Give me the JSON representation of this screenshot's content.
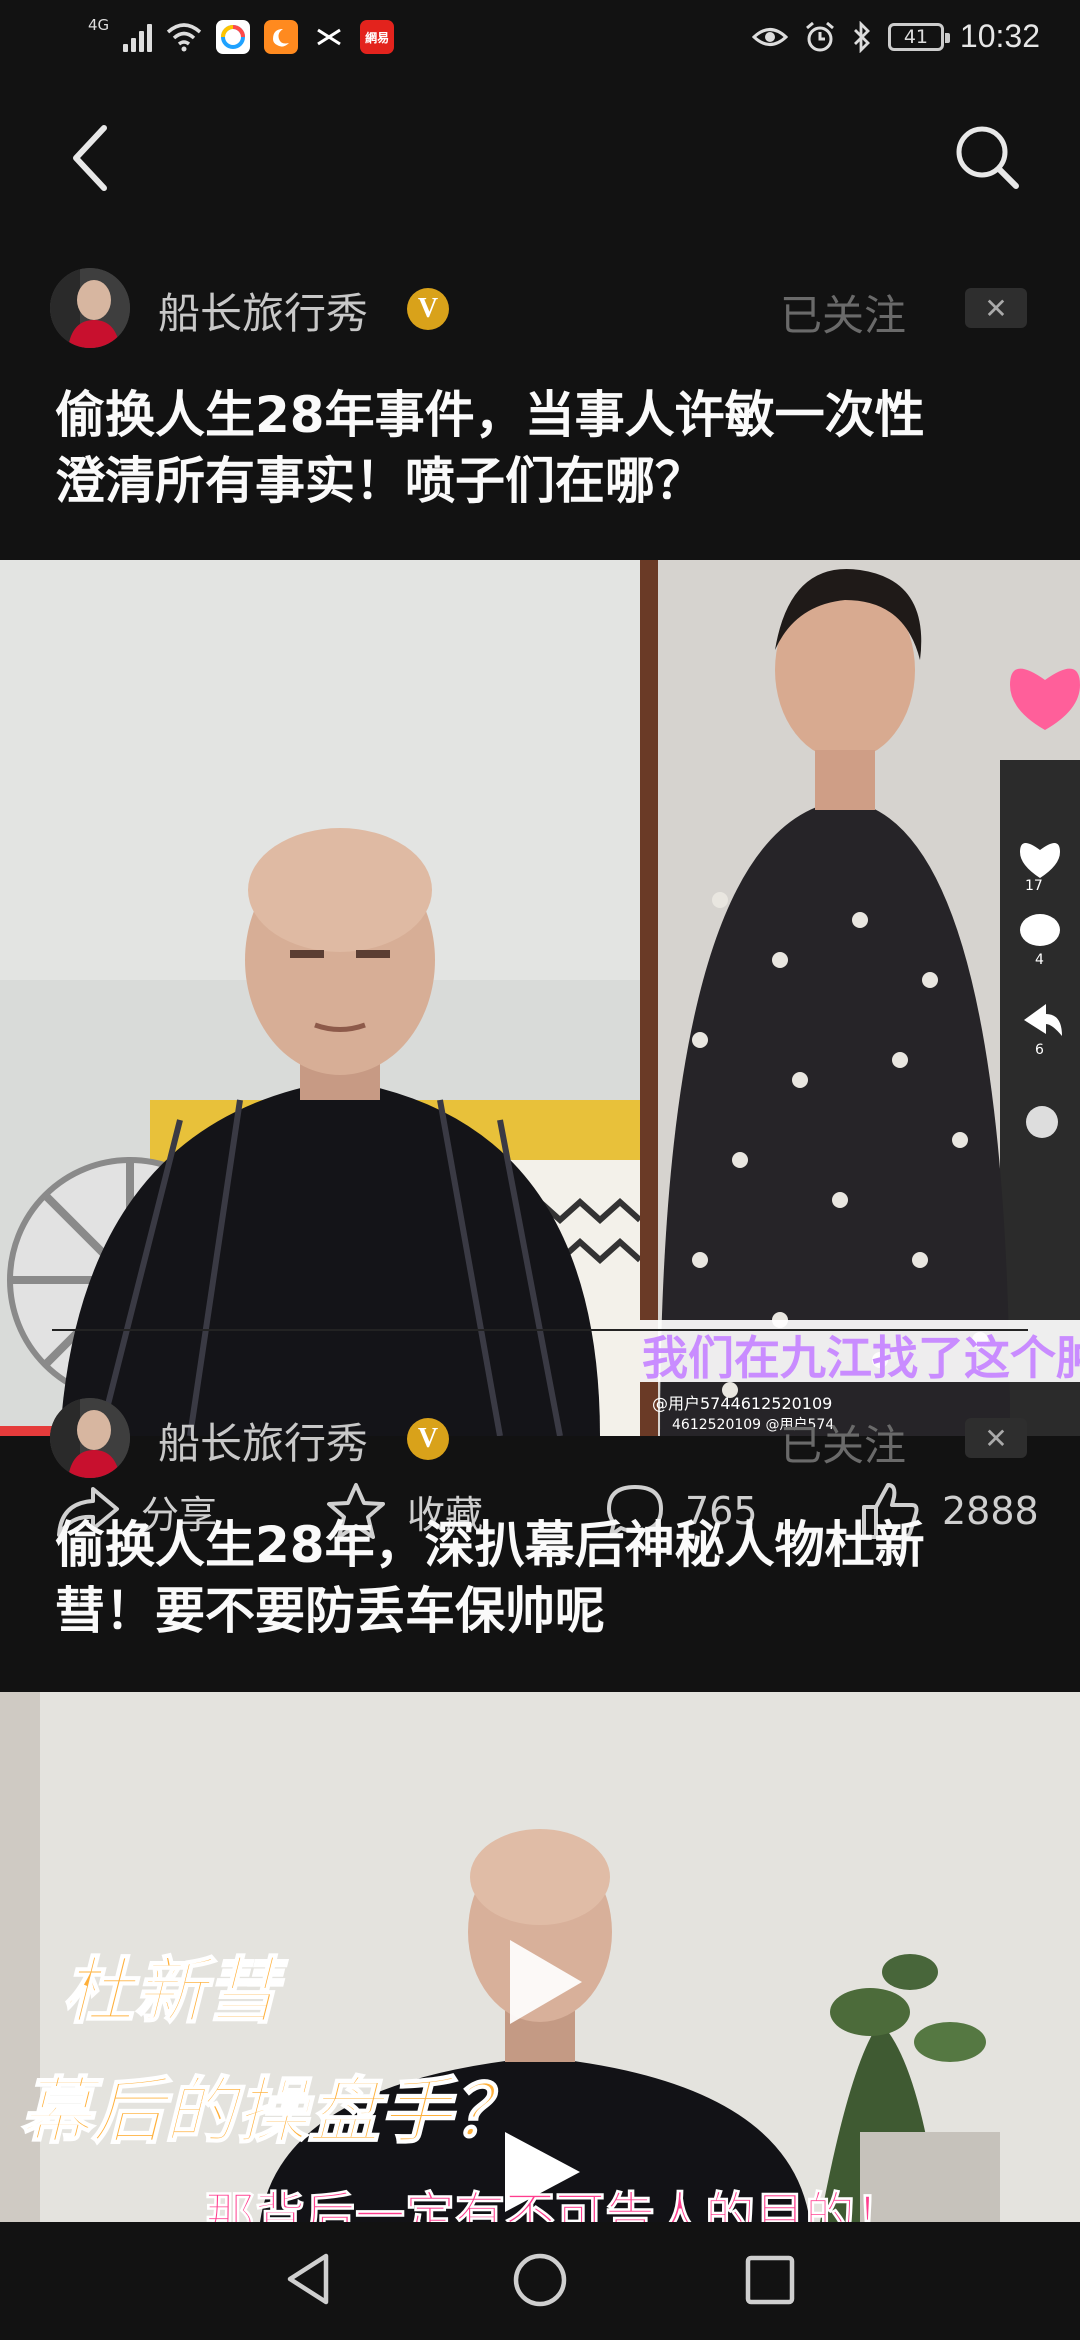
{
  "status_bar": {
    "network": "4G",
    "time": "10:32",
    "battery": "41",
    "app_icons": [
      "browser-app-icon",
      "uc-browser-app-icon",
      "capcut-app-icon",
      "netease-app-icon"
    ],
    "netease_label": "網易"
  },
  "nav": {
    "back_icon": "chevron-left-icon",
    "search_icon": "search-icon"
  },
  "posts": [
    {
      "author": "船长旅行秀",
      "verified": "V",
      "follow_label": "已关注",
      "dismiss": "✕",
      "title_line1": "偷换人生28年事件，当事人许敏一次性",
      "title_line2": "澄清所有事实！喷子们在哪？",
      "overlay_caption": "我们在九江找了这个肿",
      "overlay_user": "@用户5744612520109",
      "overlay_user2": "4612520109 @用户574",
      "side_counts": [
        "17",
        "4",
        "6"
      ],
      "share_label": "分享",
      "favorite_label": "收藏",
      "comments": "765",
      "likes": "2888"
    },
    {
      "author": "船长旅行秀",
      "verified": "V",
      "follow_label": "已关注",
      "dismiss": "✕",
      "title_line1": "偷换人生28年，深扒幕后神秘人物杜新",
      "title_line2": "彗！要不要防丢车保帅呢",
      "thumb_text1": "杜新彗",
      "thumb_text2": "幕后的操盘手？",
      "thumb_text3": "那背后一定有不可告人的目的！"
    }
  ],
  "colors": {
    "background": "#121212",
    "verified": "#d9a21a",
    "heart": "#ff5f9a",
    "caption": "#c98cff"
  }
}
